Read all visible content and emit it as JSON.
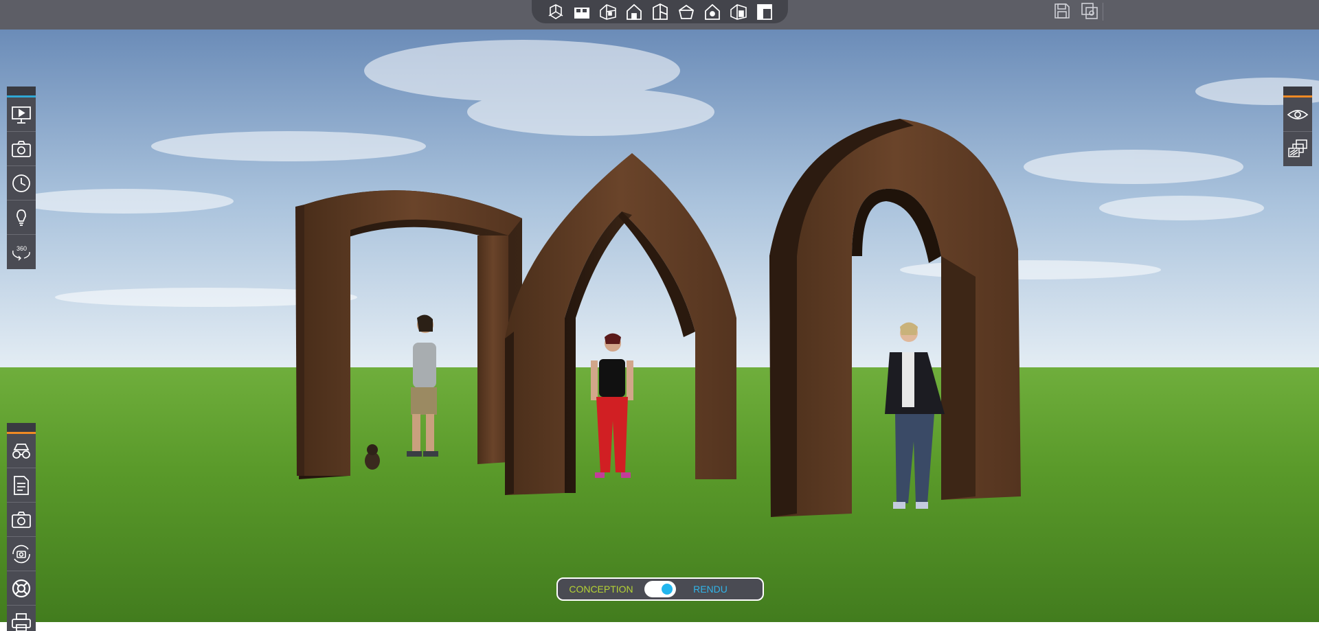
{
  "toolbar": {
    "view_buttons": [
      "perspective-view-icon",
      "plan-2d-icon",
      "3d-house-icon",
      "front-facade-icon",
      "side-facade-icon",
      "roof-view-icon",
      "house-point-icon",
      "3d-house-open-icon",
      "cut-section-icon"
    ],
    "file_buttons": [
      "save-icon",
      "save-as-icon"
    ]
  },
  "left_panel_top": {
    "buttons": [
      "presentation-icon",
      "camera-icon",
      "clock-icon",
      "lightbulb-icon",
      "360-view-icon"
    ]
  },
  "right_panel": {
    "buttons": [
      "eye-icon",
      "layers-icon"
    ]
  },
  "left_panel_bottom": {
    "buttons": [
      "visitor-glasses-icon",
      "document-icon",
      "camera-icon",
      "camera-rotate-icon",
      "help-lifebuoy-icon",
      "print-icon"
    ]
  },
  "mode_toggle": {
    "left_label": "CONCEPTION",
    "right_label": "RENDU",
    "state": "RENDU"
  },
  "colors": {
    "topbar": "#5d5e66",
    "toolbar_group": "#43444b",
    "panel": "#4a4b53",
    "accent_blue": "#22b6ee",
    "accent_orange": "#f08a24",
    "conception_green": "#b5d334"
  }
}
